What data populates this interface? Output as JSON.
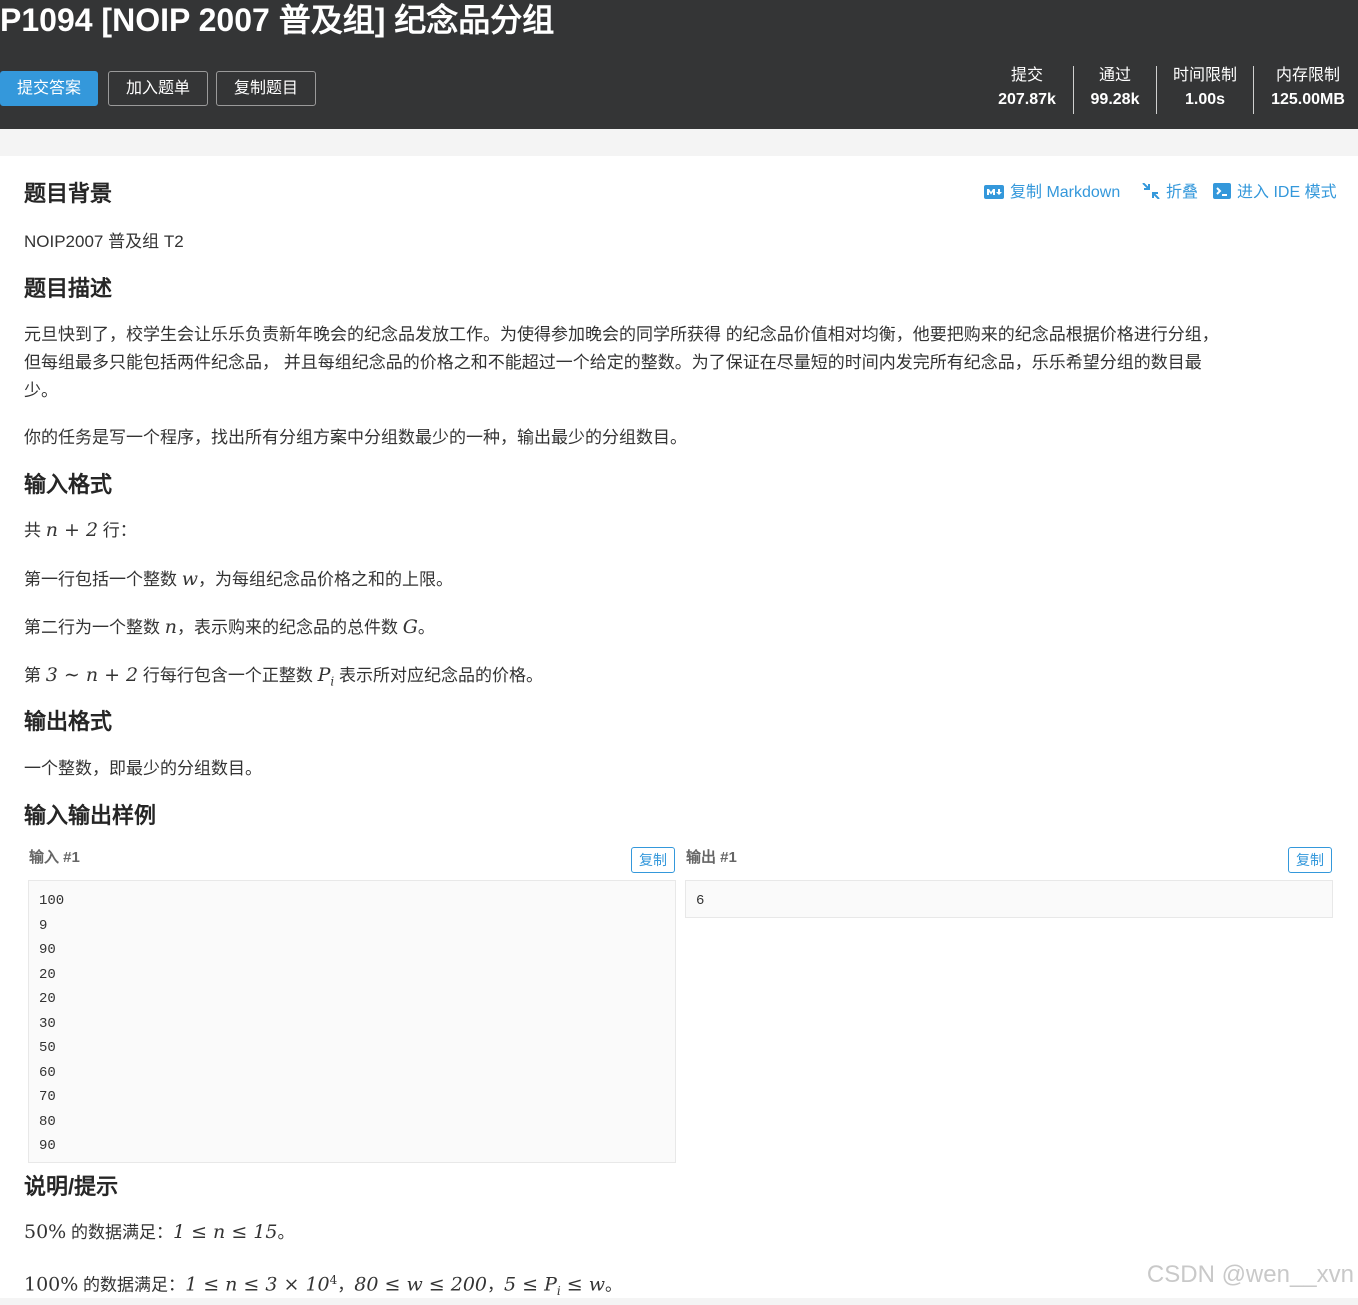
{
  "problem": {
    "title": "P1094 [NOIP 2007 普及组] 纪念品分组"
  },
  "toolbar": {
    "submit_label": "提交答案",
    "add_label": "加入题单",
    "copy_label": "复制题目"
  },
  "stats": [
    {
      "label": "提交",
      "value": "207.87k"
    },
    {
      "label": "通过",
      "value": "99.28k"
    },
    {
      "label": "时间限制",
      "value": "1.00s"
    },
    {
      "label": "内存限制",
      "value": "125.00MB"
    }
  ],
  "actions": {
    "copy_markdown": "复制 Markdown",
    "fold": "折叠",
    "ide": "进入 IDE 模式"
  },
  "sections": {
    "background": {
      "heading": "题目背景",
      "text": "NOIP2007 普及组 T2"
    },
    "description": {
      "heading": "题目描述",
      "p1_line1": "元旦快到了，校学生会让乐乐负责新年晚会的纪念品发放工作。为使得参加晚会的同学所获得 的纪念品价值相对均衡，他要把购来的纪念品根据价格进行分组，",
      "p1_line2": "但每组最多只能包括两件纪念品， 并且每组纪念品的价格之和不能超过一个给定的整数。为了保证在尽量短的时间内发完所有纪念品，乐乐希望分组的数目最",
      "p1_line3": "少。",
      "p2": "你的任务是写一个程序，找出所有分组方案中分组数最少的一种，输出最少的分组数目。"
    },
    "input": {
      "heading": "输入格式",
      "l1_a": "共 ",
      "l1_m": "n + 2",
      "l1_b": " 行：",
      "l2_a": "第一行包括一个整数 ",
      "l2_m": "w",
      "l2_b": "，为每组纪念品价格之和的上限。",
      "l3_a": "第二行为一个整数 ",
      "l3_m1": "n",
      "l3_b": "，表示购来的纪念品的总件数 ",
      "l3_m2": "G",
      "l3_c": "。",
      "l4_a": "第 ",
      "l4_m1": "3 ∼ n + 2",
      "l4_b": " 行每行包含一个正整数 ",
      "l4_m2": "P",
      "l4_sub": "i",
      "l4_c": " 表示所对应纪念品的价格。"
    },
    "output": {
      "heading": "输出格式",
      "text": "一个整数，即最少的分组数目。"
    },
    "samples": {
      "heading": "输入输出样例",
      "input_label": "输入 #1",
      "output_label": "输出 #1",
      "copy": "复制",
      "input_lines": [
        "100",
        "9",
        "90",
        "20",
        "20",
        "30",
        "50",
        "60",
        "70",
        "80",
        "90"
      ],
      "output_lines": [
        "6"
      ]
    },
    "hint": {
      "heading": "说明/提示",
      "h1_m1": "50%",
      "h1_a": " 的数据满足：",
      "h1_m2": "1 ≤ n ≤ 15",
      "h1_b": "。",
      "h2_m1": "100%",
      "h2_a": " 的数据满足：",
      "h2_m2": "1 ≤ n ≤ 3 × 10",
      "h2_sup": "4",
      "h2_sep1": "，",
      "h2_m3": "80 ≤ w ≤ 200",
      "h2_sep2": "，",
      "h2_m4": "5 ≤ P",
      "h2_sub": "i",
      "h2_m5": " ≤ w",
      "h2_end": "。"
    }
  },
  "watermark": "CSDN @wen__xvn",
  "colors": {
    "header_bg": "#343536",
    "accent": "#3498db",
    "page_bg": "#f4f4f4"
  }
}
